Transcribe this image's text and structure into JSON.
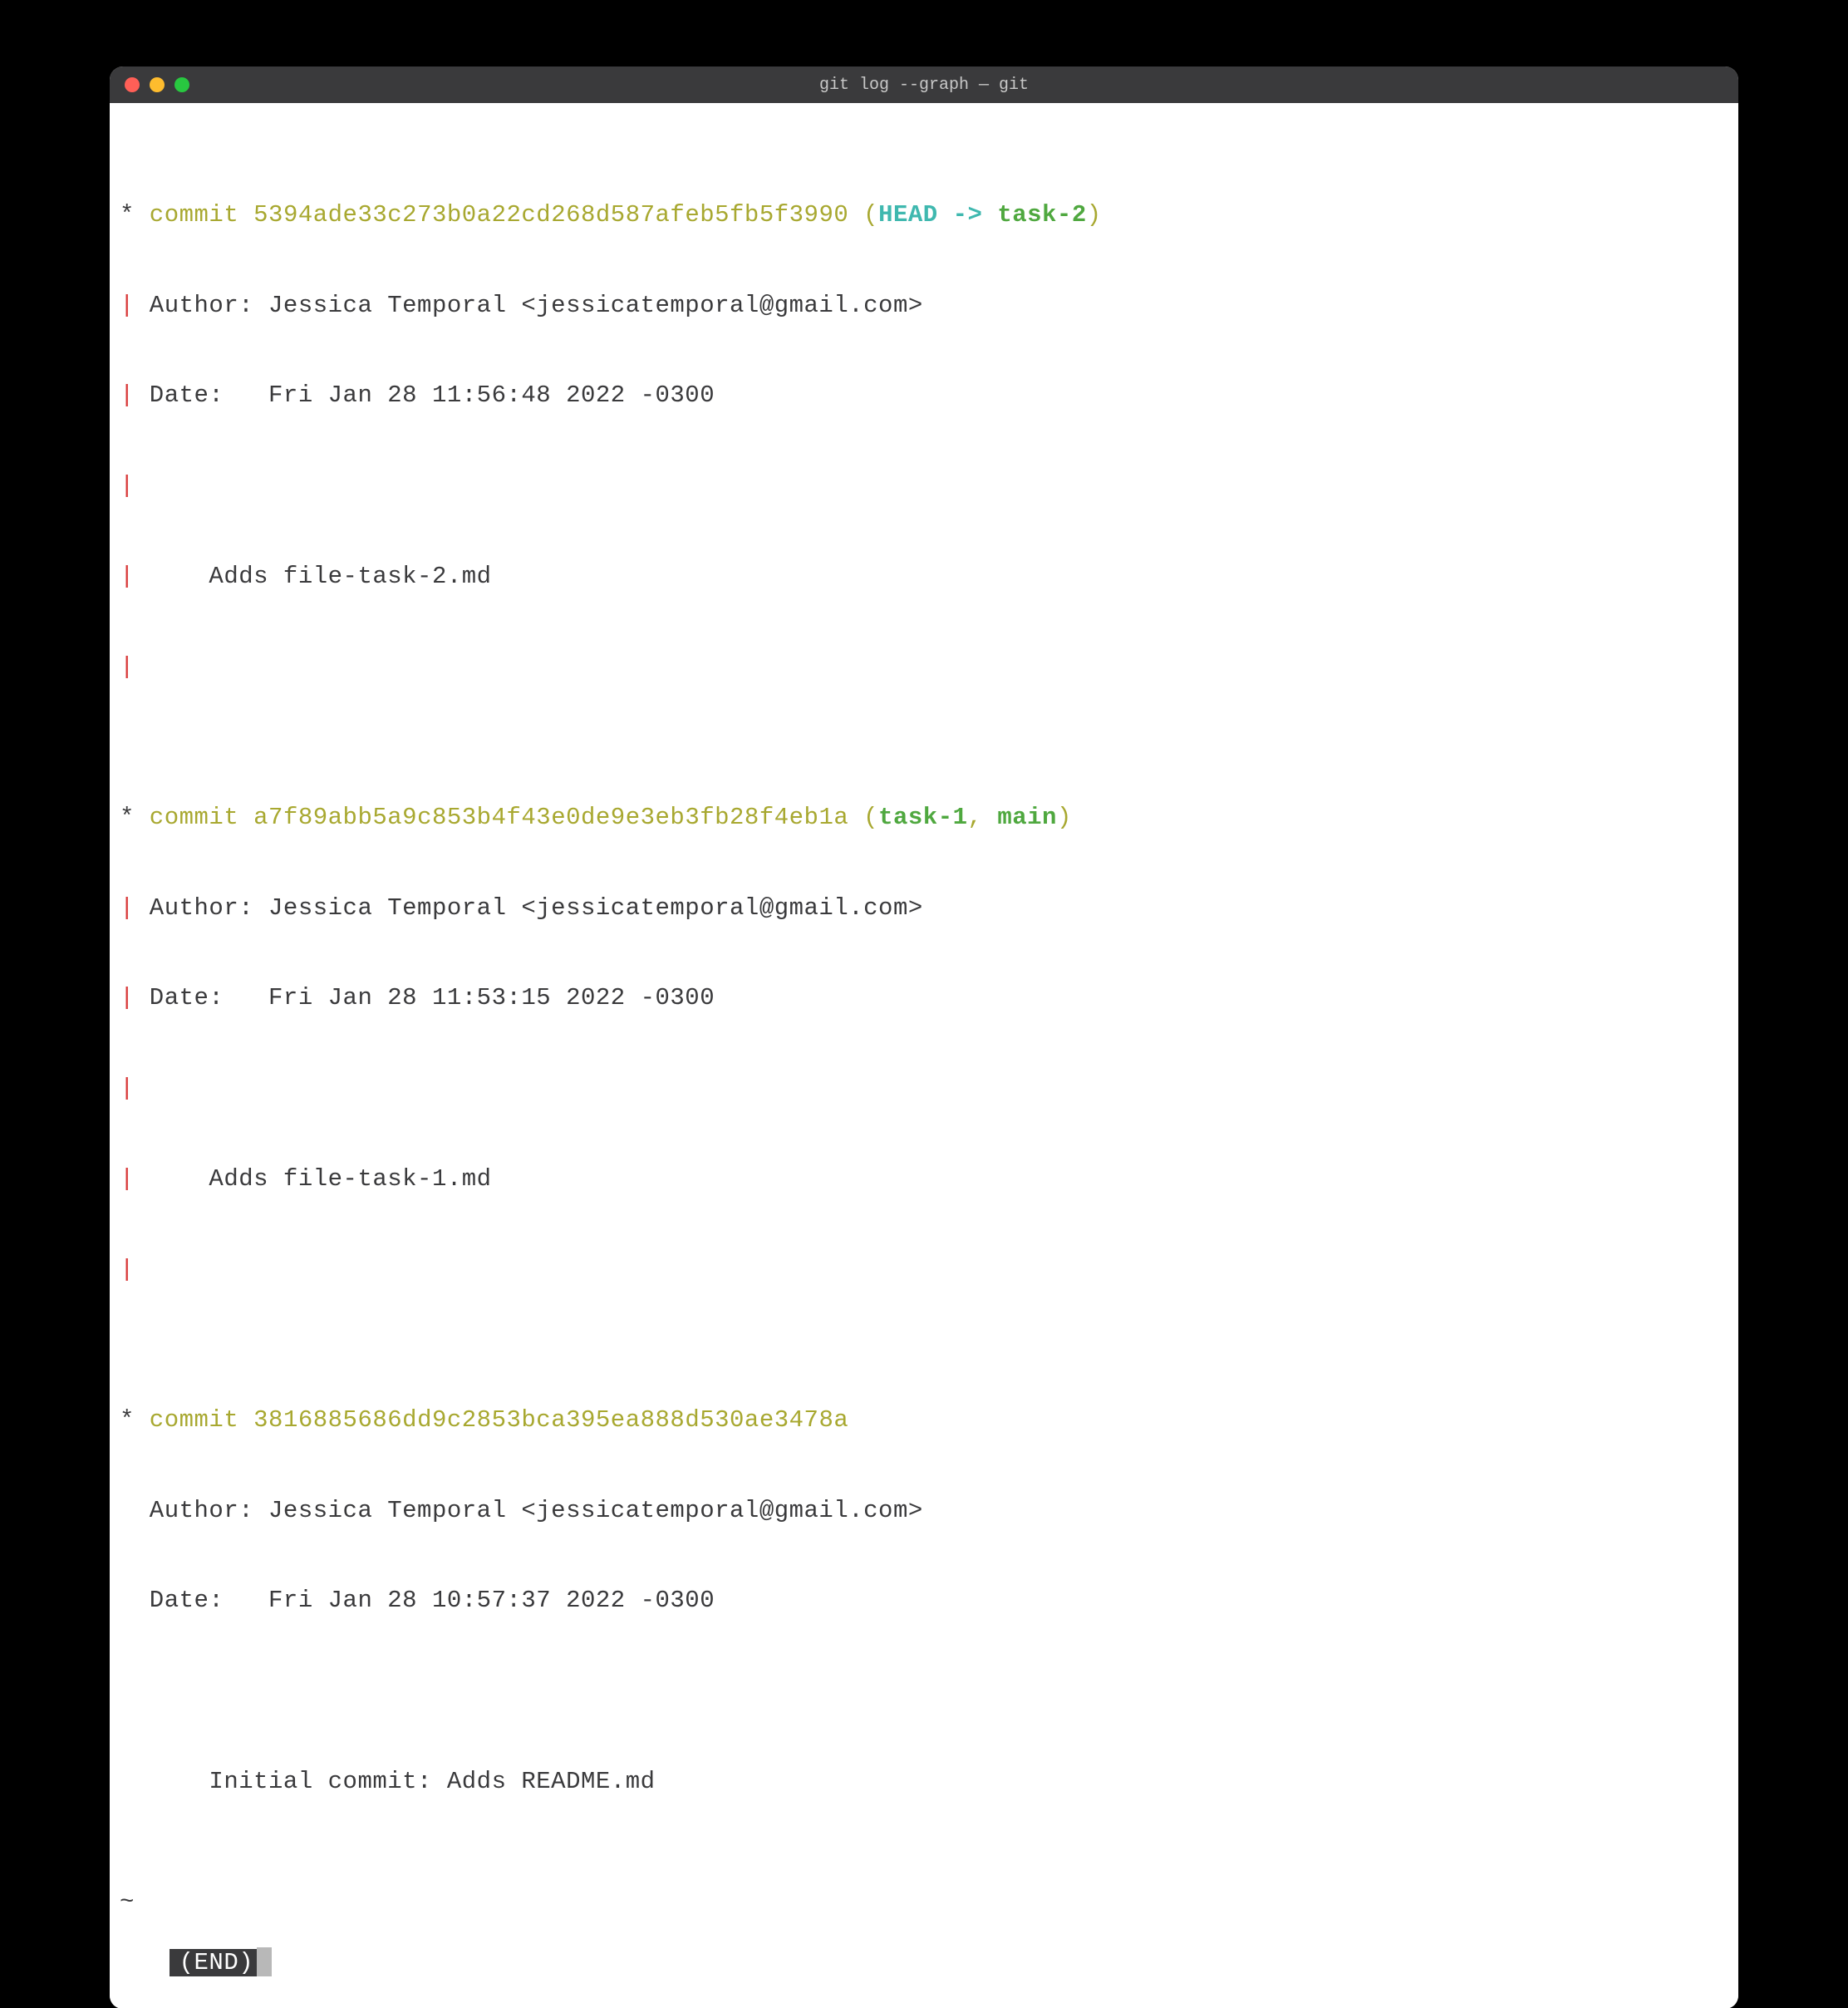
{
  "window": {
    "title": "git log --graph — git"
  },
  "commits": [
    {
      "star": "*",
      "commit_prefix": " commit ",
      "hash": "5394ade33c273b0a22cd268d587afeb5fb5f3990",
      "paren_open": " (",
      "head": "HEAD -> ",
      "branch": "task-2",
      "paren_close": ")",
      "pipe": "|",
      "author": " Author: Jessica Temporal <jessicatemporal@gmail.com>",
      "date": " Date:   Fri Jan 28 11:56:48 2022 -0300",
      "blank_pipe": "|",
      "message": "     Adds file-task-2.md",
      "trailing_pipe": "|"
    },
    {
      "star": "*",
      "commit_prefix": " commit ",
      "hash": "a7f89abb5a9c853b4f43e0de9e3eb3fb28f4eb1a",
      "paren_open": " (",
      "branches": "task-1",
      "comma": ", ",
      "main": "main",
      "paren_close": ")",
      "pipe": "|",
      "author": " Author: Jessica Temporal <jessicatemporal@gmail.com>",
      "date": " Date:   Fri Jan 28 11:53:15 2022 -0300",
      "blank_pipe": "|",
      "message": "     Adds file-task-1.md",
      "trailing_pipe": "|"
    },
    {
      "star": "*",
      "commit_prefix": " commit ",
      "hash": "3816885686dd9c2853bca395ea888d530ae3478a",
      "indent": " ",
      "author": " Author: Jessica Temporal <jessicatemporal@gmail.com>",
      "date": " Date:   Fri Jan 28 10:57:37 2022 -0300",
      "blank": " ",
      "message": "     Initial commit: Adds README.md"
    }
  ],
  "tilde": "~",
  "end_marker": "(END)"
}
